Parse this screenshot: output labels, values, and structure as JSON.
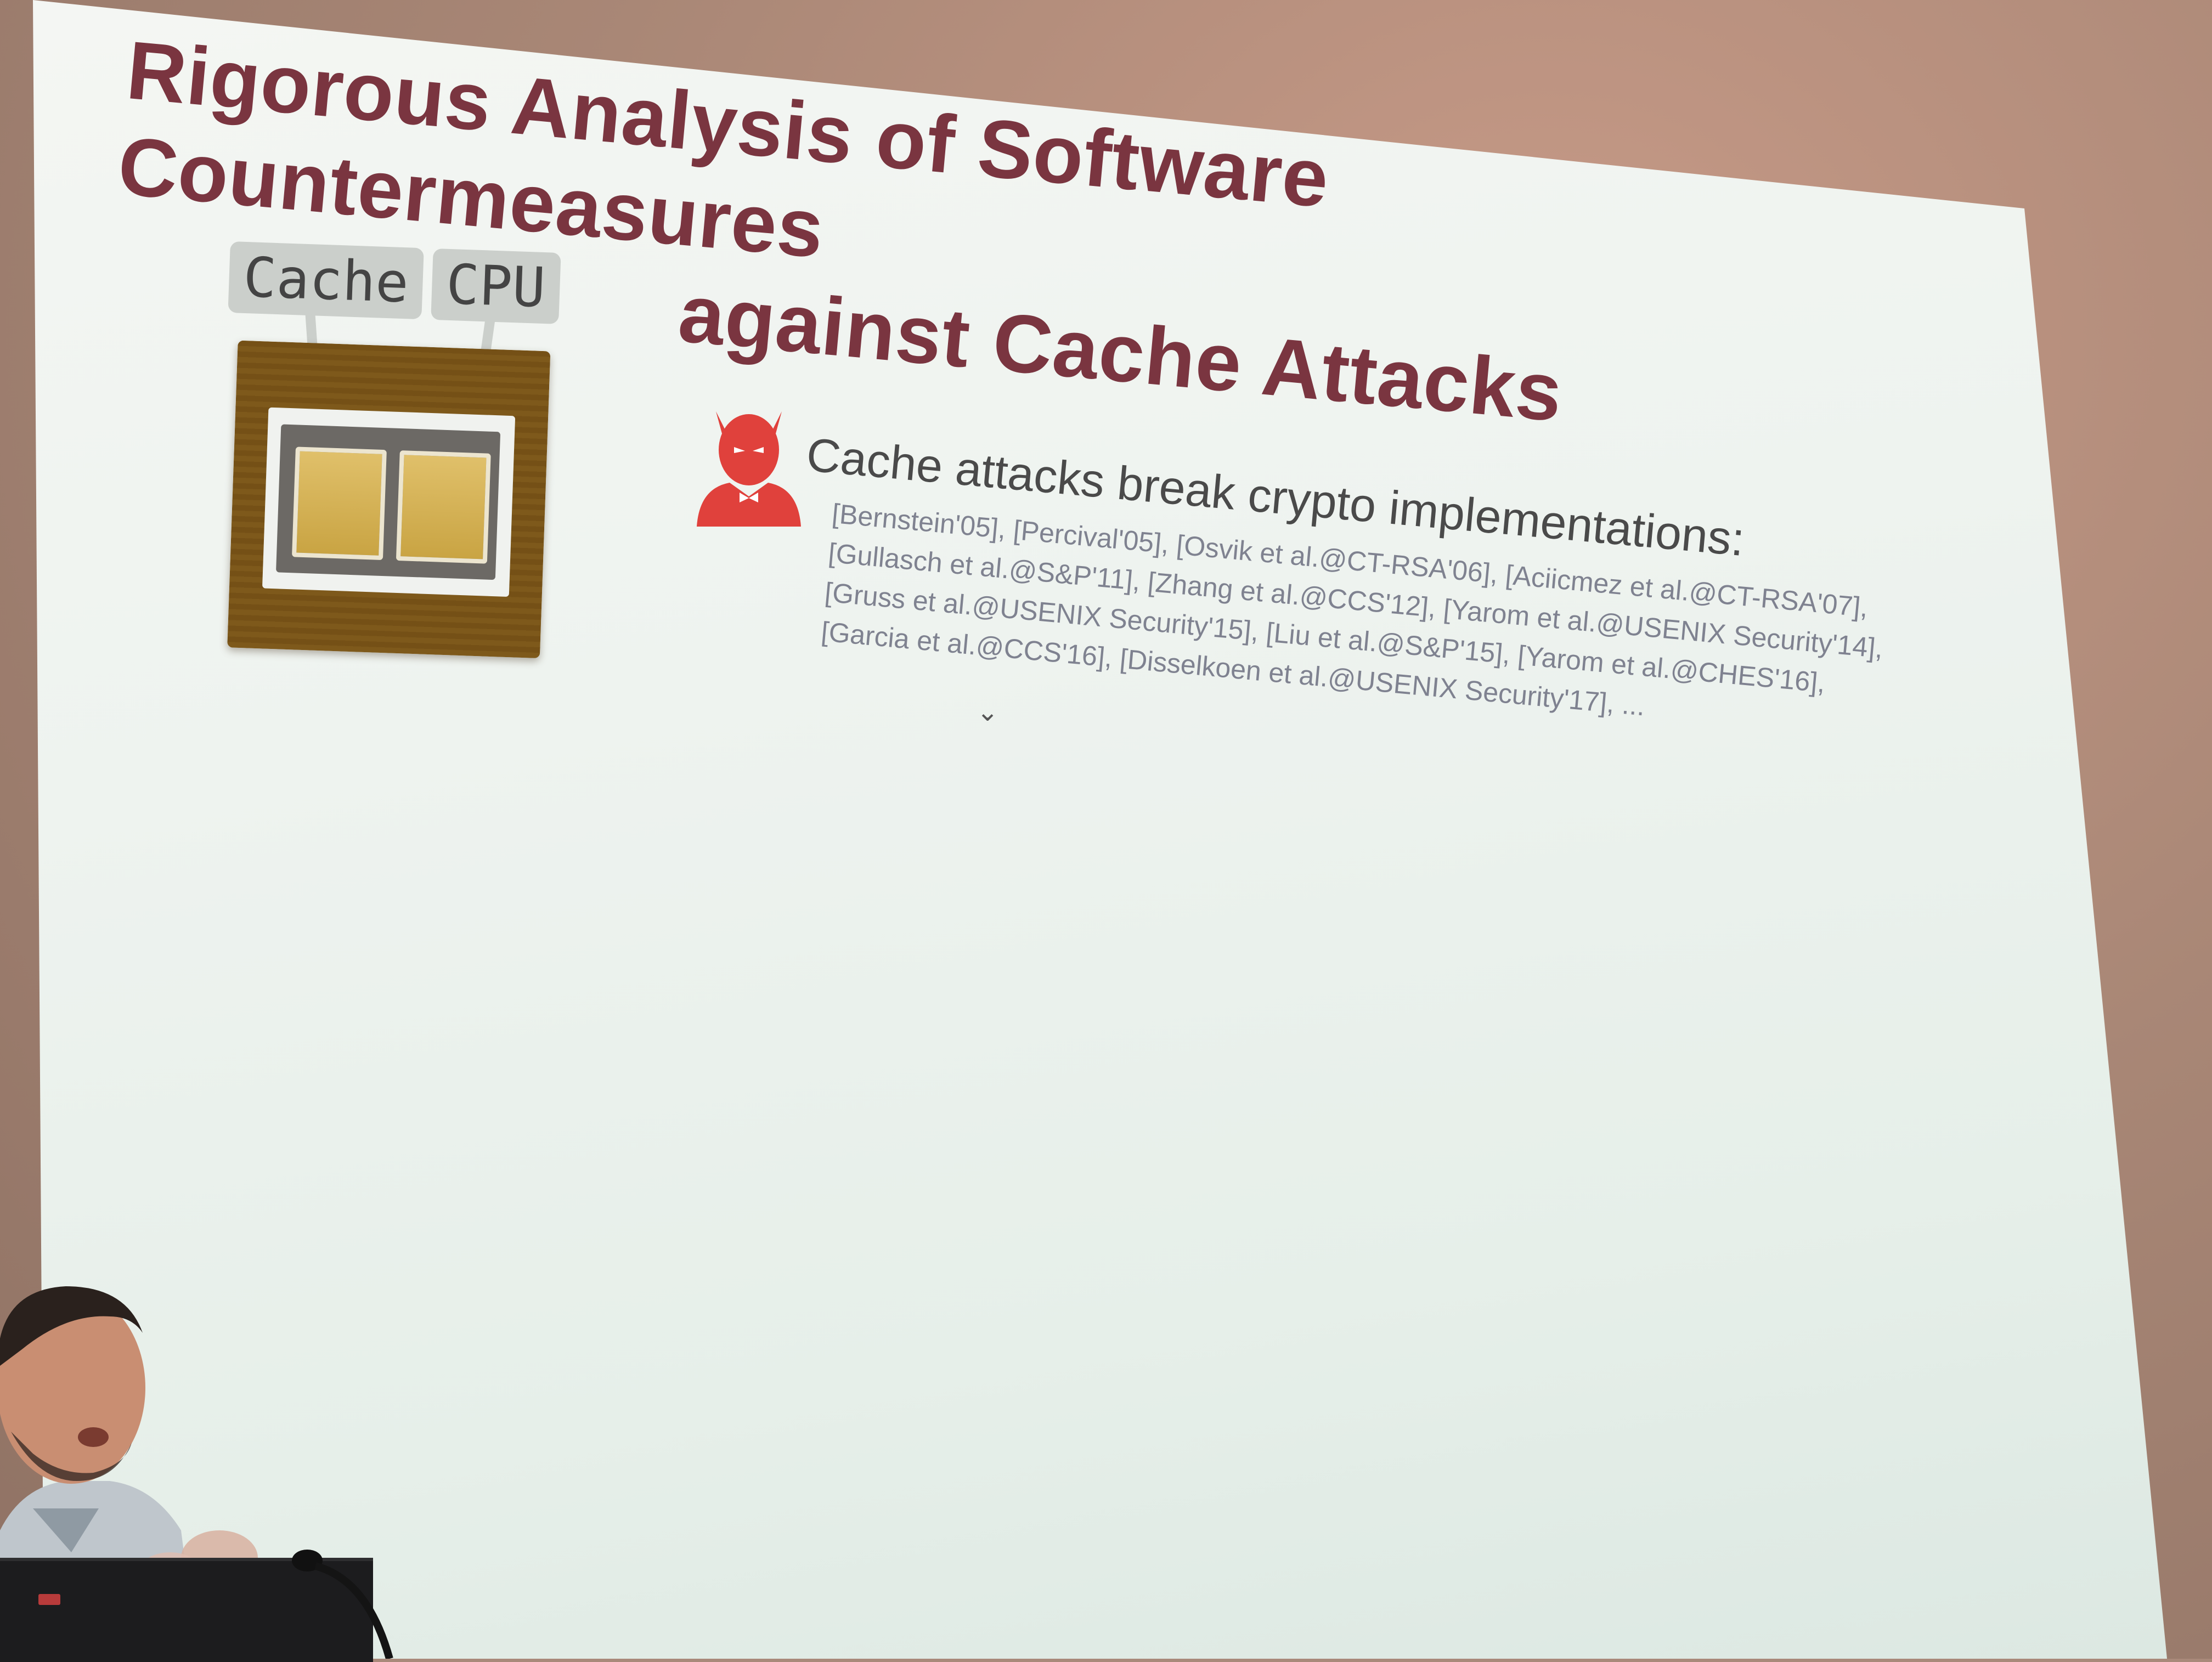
{
  "slide": {
    "title_line1": "Rigorous Analysis of Software Countermeasures",
    "title_line2": "against Cache Attacks",
    "chip_labels": {
      "cache": "Cache",
      "cpu": "CPU"
    },
    "bullet": "Cache attacks break crypto implementations:",
    "references": [
      "[Bernstein'05], [Percival'05], [Osvik et al.@CT-RSA'06], [Aciicmez et al.@CT-RSA'07],",
      "[Gullasch et al.@S&P'11], [Zhang et al.@CCS'12], [Yarom et al.@USENIX Security'14],",
      "[Gruss et al.@USENIX Security'15], [Liu et al.@S&P'15], [Yarom et al.@CHES'16],",
      "[Garcia et al.@CCS'16], [Disselkoen et al.@USENIX Security'17], ..."
    ],
    "icons": {
      "attacker": "devil-icon",
      "hardware": "cpu-chip-icon"
    },
    "colors": {
      "title": "#7a3540",
      "devil": "#e0413c",
      "screen": "#eef3ef",
      "wall": "#a98776"
    }
  }
}
